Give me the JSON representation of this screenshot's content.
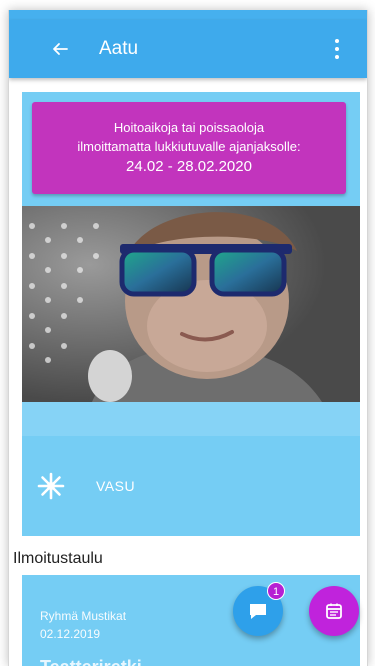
{
  "appbar": {
    "title": "Aatu",
    "back_icon": "arrow-left-icon",
    "menu_icon": "more-vertical-icon",
    "color": "#3eaaec"
  },
  "notice": {
    "line1": "Hoitoaikoja tai poissaoloja",
    "line2": "ilmoittamatta lukkiutuvalle ajanjaksolle:",
    "dates": "24.02 - 28.02.2020",
    "color": "#c234bd"
  },
  "child_card": {
    "photo_icon": "child-photo",
    "vasu_icon": "snowflake-icon",
    "vasu_label": "VASU",
    "color": "#75cdf4"
  },
  "bulletin": {
    "section_title": "Ilmoitustaulu",
    "post": {
      "group": "Ryhmä Mustikat",
      "date": "02.12.2019",
      "title": "Teatteriretki"
    }
  },
  "fabs": {
    "chat": {
      "icon": "chat-icon",
      "badge": "1",
      "color": "#2ea0ea"
    },
    "calendar": {
      "icon": "calendar-icon",
      "color": "#c023dc"
    }
  }
}
